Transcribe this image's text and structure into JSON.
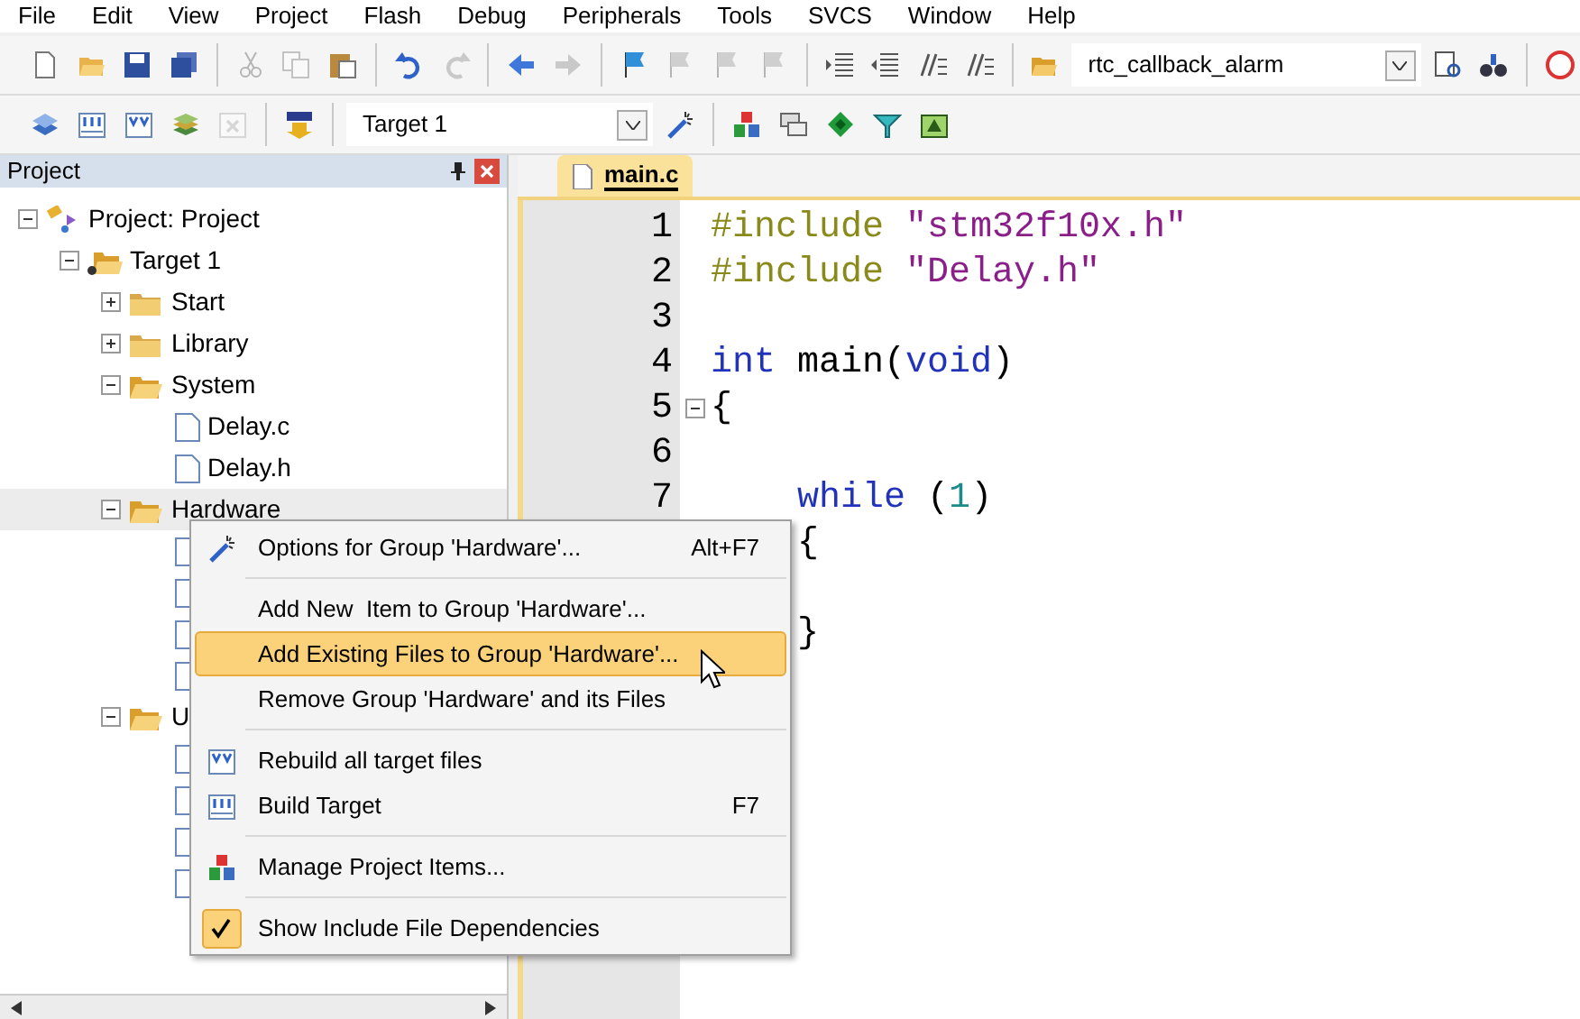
{
  "menu_bar": [
    "File",
    "Edit",
    "View",
    "Project",
    "Flash",
    "Debug",
    "Peripherals",
    "Tools",
    "SVCS",
    "Window",
    "Help"
  ],
  "toolbar_1": [
    {
      "kind": "new",
      "disabled": false
    },
    {
      "kind": "open",
      "disabled": false
    },
    {
      "kind": "save",
      "disabled": false
    },
    {
      "kind": "saveall",
      "disabled": false
    },
    {
      "kind": "separator"
    },
    {
      "kind": "cut",
      "disabled": true
    },
    {
      "kind": "copy",
      "disabled": true
    },
    {
      "kind": "paste",
      "disabled": false
    },
    {
      "kind": "separator"
    },
    {
      "kind": "undo",
      "disabled": false
    },
    {
      "kind": "redo",
      "disabled": true
    },
    {
      "kind": "separator"
    },
    {
      "kind": "back",
      "disabled": false
    },
    {
      "kind": "forward",
      "disabled": true
    },
    {
      "kind": "separator"
    },
    {
      "kind": "flag",
      "disabled": false
    },
    {
      "kind": "flag2",
      "disabled": true
    },
    {
      "kind": "flag2",
      "disabled": true
    },
    {
      "kind": "flag2",
      "disabled": true
    },
    {
      "kind": "separator"
    },
    {
      "kind": "indent",
      "disabled": false
    },
    {
      "kind": "outdent",
      "disabled": false
    },
    {
      "kind": "comment",
      "disabled": false
    },
    {
      "kind": "comment",
      "disabled": false
    },
    {
      "kind": "separator"
    },
    {
      "kind": "openfolder",
      "disabled": false
    },
    {
      "kind": "combo",
      "value": "rtc_callback_alarm"
    },
    {
      "kind": "findfile",
      "disabled": false
    },
    {
      "kind": "debug",
      "disabled": false
    },
    {
      "kind": "separator"
    },
    {
      "kind": "magnifier",
      "disabled": false
    }
  ],
  "toolbar_2": [
    {
      "kind": "translate",
      "disabled": false
    },
    {
      "kind": "build",
      "disabled": false
    },
    {
      "kind": "rebuild",
      "disabled": false
    },
    {
      "kind": "batch",
      "disabled": false
    },
    {
      "kind": "stop",
      "disabled": true
    },
    {
      "kind": "separator"
    },
    {
      "kind": "load",
      "disabled": false
    },
    {
      "kind": "separator"
    },
    {
      "kind": "combo",
      "value": "Target 1"
    },
    {
      "kind": "wand",
      "disabled": false
    },
    {
      "kind": "separator"
    },
    {
      "kind": "blocks",
      "disabled": false
    },
    {
      "kind": "windows",
      "disabled": false
    },
    {
      "kind": "diamond",
      "disabled": false
    },
    {
      "kind": "funnel",
      "disabled": false
    },
    {
      "kind": "pack",
      "disabled": false
    }
  ],
  "project_panel": {
    "title": "Project",
    "tree": [
      {
        "kind": "project",
        "label": "Project: Project",
        "expanded": true,
        "selected": false,
        "children": [
          {
            "kind": "target",
            "label": "Target 1",
            "expanded": true,
            "selected": false,
            "children": [
              {
                "kind": "group",
                "label": "Start",
                "expanded": false,
                "selected": false
              },
              {
                "kind": "group",
                "label": "Library",
                "expanded": false,
                "selected": false
              },
              {
                "kind": "group",
                "label": "System",
                "expanded": true,
                "selected": false,
                "children": [
                  {
                    "kind": "file",
                    "label": "Delay.c",
                    "selected": false
                  },
                  {
                    "kind": "file",
                    "label": "Delay.h",
                    "selected": false
                  }
                ]
              },
              {
                "kind": "group",
                "label": "Hardware",
                "expanded": true,
                "selected": true,
                "children": [
                  {
                    "kind": "file",
                    "selected": false
                  },
                  {
                    "kind": "file",
                    "selected": false
                  },
                  {
                    "kind": "file",
                    "selected": false
                  },
                  {
                    "kind": "file",
                    "selected": false
                  }
                ]
              },
              {
                "kind": "group",
                "label": "U",
                "expanded": true,
                "selected": false,
                "children": [
                  {
                    "kind": "file",
                    "selected": false
                  },
                  {
                    "kind": "file",
                    "selected": false
                  },
                  {
                    "kind": "file",
                    "selected": false
                  },
                  {
                    "kind": "file",
                    "selected": false
                  }
                ]
              }
            ]
          }
        ]
      }
    ]
  },
  "editor": {
    "tabs": [
      {
        "label": "main.c",
        "selected": true
      }
    ],
    "lines": [
      {
        "number": "1",
        "tokens": [
          {
            "kind": "directive",
            "text": "#include "
          },
          {
            "kind": "string",
            "text": "\"stm32f10x.h\""
          }
        ]
      },
      {
        "number": "2",
        "tokens": [
          {
            "kind": "directive",
            "text": "#include "
          },
          {
            "kind": "string",
            "text": "\"Delay.h\""
          }
        ]
      },
      {
        "number": "3"
      },
      {
        "number": "4",
        "tokens": [
          {
            "kind": "keyword",
            "text": "int"
          },
          {
            "kind": "plain",
            "text": " main("
          },
          {
            "kind": "keyword",
            "text": "void"
          },
          {
            "kind": "plain",
            "text": ")"
          }
        ]
      },
      {
        "number": "5",
        "fold": true,
        "tokens": [
          {
            "kind": "plain",
            "text": "{"
          }
        ]
      },
      {
        "number": "6"
      },
      {
        "number": "7",
        "tokens": [
          {
            "kind": "keyword",
            "text": "    while"
          },
          {
            "kind": "plain",
            "text": " ("
          },
          {
            "kind": "number",
            "text": "1"
          },
          {
            "kind": "plain",
            "text": ")"
          }
        ]
      },
      {
        "tokens": [
          {
            "kind": "plain",
            "text": "    {"
          }
        ]
      },
      {
        "tokens": [
          {
            "kind": "plain",
            "text": "\n    }"
          }
        ]
      }
    ]
  },
  "context_menu": [
    {
      "kind": "item",
      "label": "Options for Group 'Hardware'...",
      "shortcut": "Alt+F7",
      "selected": false
    },
    {
      "kind": "separator"
    },
    {
      "kind": "item",
      "label": "Add New  Item to Group 'Hardware'...",
      "selected": false
    },
    {
      "kind": "item",
      "label": "Add Existing Files to Group 'Hardware'...",
      "selected": true
    },
    {
      "kind": "item",
      "label": "Remove Group 'Hardware' and its Files",
      "selected": false
    },
    {
      "kind": "separator"
    },
    {
      "kind": "item",
      "label": "Rebuild all target files",
      "selected": false
    },
    {
      "kind": "item",
      "label": "Build Target",
      "shortcut": "F7",
      "selected": false
    },
    {
      "kind": "separator"
    },
    {
      "kind": "item",
      "label": "Manage Project Items...",
      "selected": false
    },
    {
      "kind": "separator"
    },
    {
      "kind": "item",
      "label": "Show Include File Dependencies",
      "checked": true,
      "selected": false
    }
  ]
}
